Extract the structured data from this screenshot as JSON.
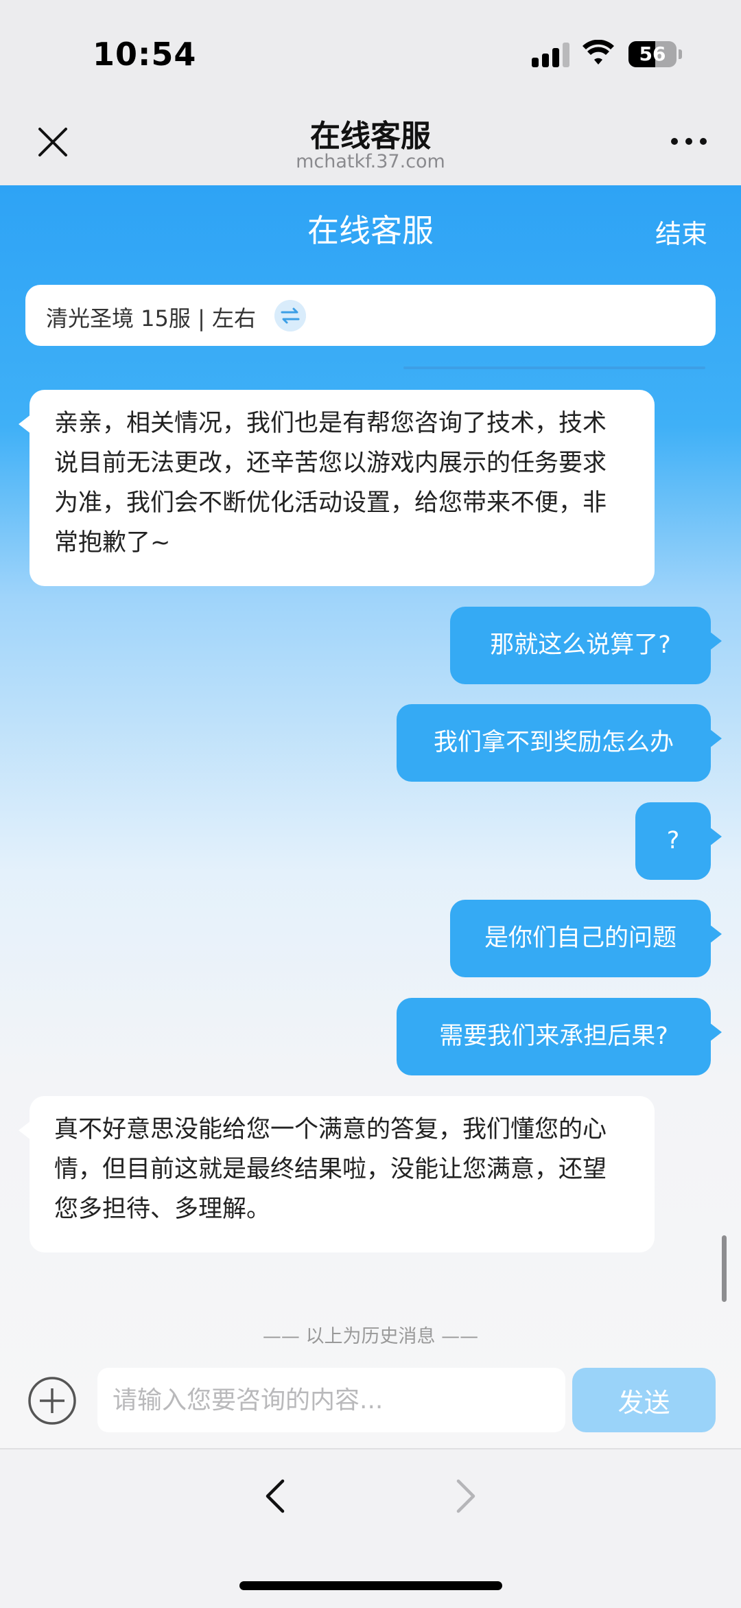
{
  "status_bar": {
    "time": "10:54",
    "battery": "56"
  },
  "browser": {
    "title": "在线客服",
    "url": "mchatkf.37.com"
  },
  "chat_header": {
    "title": "在线客服",
    "end_label": "结束"
  },
  "server": {
    "label": "清光圣境 15服 | 左右"
  },
  "messages": [
    {
      "side": "left",
      "text": "亲亲，相关情况，我们也是有帮您咨询了技术，技术说目前无法更改，还辛苦您以游戏内展示的任务要求为准，我们会不断优化活动设置，给您带来不便，非常抱歉了~"
    },
    {
      "side": "right",
      "text": "那就这么说算了?"
    },
    {
      "side": "right",
      "text": "我们拿不到奖励怎么办"
    },
    {
      "side": "right",
      "text": "?"
    },
    {
      "side": "right",
      "text": "是你们自己的问题"
    },
    {
      "side": "right",
      "text": "需要我们来承担后果?"
    },
    {
      "side": "left",
      "text": "真不好意思没能给您一个满意的答复，我们懂您的心情，但目前这就是最终结果啦，没能让您满意，还望您多担待、多理解。"
    }
  ],
  "history_note": "—— 以上为历史消息 ——",
  "input": {
    "placeholder": "请输入您要咨询的内容...",
    "value": ""
  },
  "send_label": "发送",
  "colors": {
    "accent": "#35aaf4",
    "header_top": "#2ea3f5",
    "send_disabled": "#9ad3f9"
  }
}
